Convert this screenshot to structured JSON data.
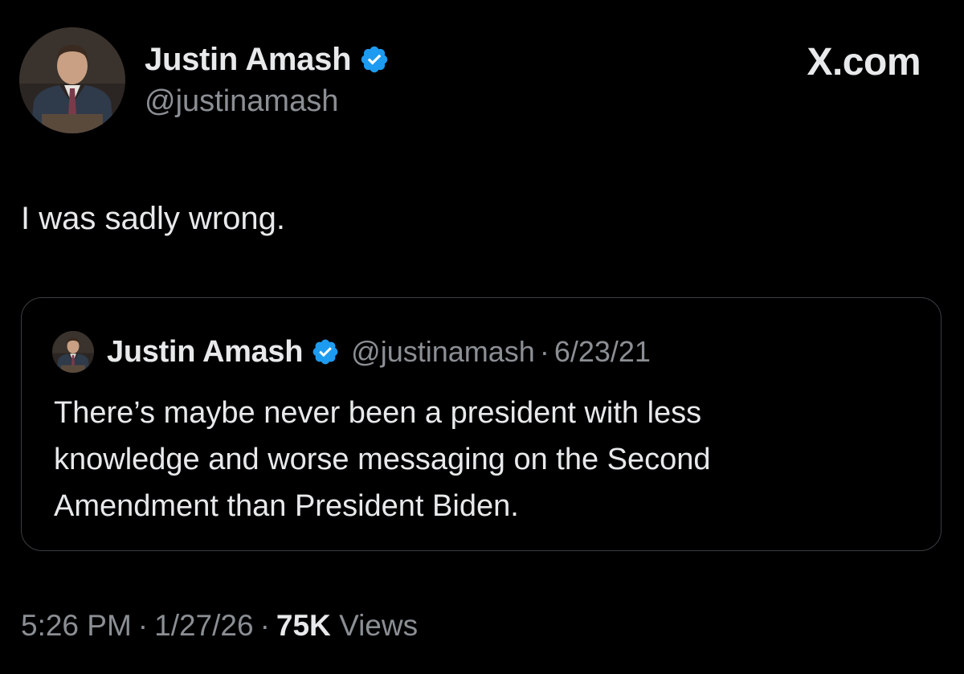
{
  "tweet": {
    "author": {
      "name": "Justin Amash",
      "handle": "@justinamash",
      "verified_color": "#1d9bf0"
    },
    "site": "X.com",
    "text": "I was sadly wrong.",
    "quoted": {
      "author_name": "Justin Amash",
      "handle": "@justinamash",
      "separator": "·",
      "date": "6/23/21",
      "lines": [
        "There’s maybe never been a president with less",
        "knowledge and worse messaging on the Second",
        "Amendment than President Biden."
      ]
    },
    "meta": {
      "time": "5:26 PM",
      "separator": "·",
      "date": "1/27/26",
      "views_count": "75K",
      "views_label": "Views"
    }
  },
  "colors": {
    "background": "#000000",
    "text_primary": "#e7e9ea",
    "text_secondary": "#8b8f94",
    "card_border": "#3a3d41",
    "verified_blue": "#1d9bf0"
  },
  "icons": [
    "verified-badge-icon",
    "avatar-photo"
  ]
}
